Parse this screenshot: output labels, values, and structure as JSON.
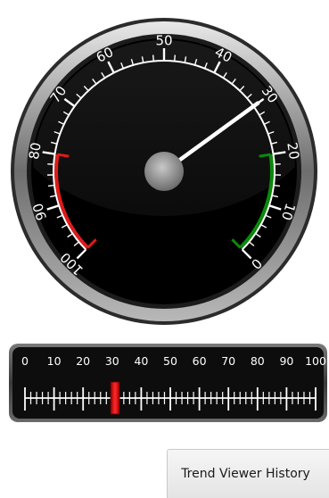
{
  "gauge": {
    "value": 30,
    "min": 0,
    "max": 100,
    "major_labels": [
      "0",
      "10",
      "20",
      "30",
      "40",
      "50",
      "60",
      "70",
      "80",
      "90",
      "100"
    ],
    "green_band": [
      0,
      20
    ],
    "red_band": [
      80,
      100
    ],
    "colors": {
      "green": "#0a8a0a",
      "red": "#e01a1a",
      "needle": "#ffffff",
      "face": "#000000",
      "bezel": "#8c8c8c",
      "hub": "#9a9a9a"
    }
  },
  "linear_gauge": {
    "value": 31,
    "min": 0,
    "max": 100,
    "labels": [
      "0",
      "10",
      "20",
      "30",
      "40",
      "50",
      "60",
      "70",
      "80",
      "90",
      "100"
    ],
    "colors": {
      "pointer": "#d81414",
      "background": "#111111",
      "ticks": "#ffffff"
    }
  },
  "trend_button": {
    "label": "Trend Viewer History"
  }
}
